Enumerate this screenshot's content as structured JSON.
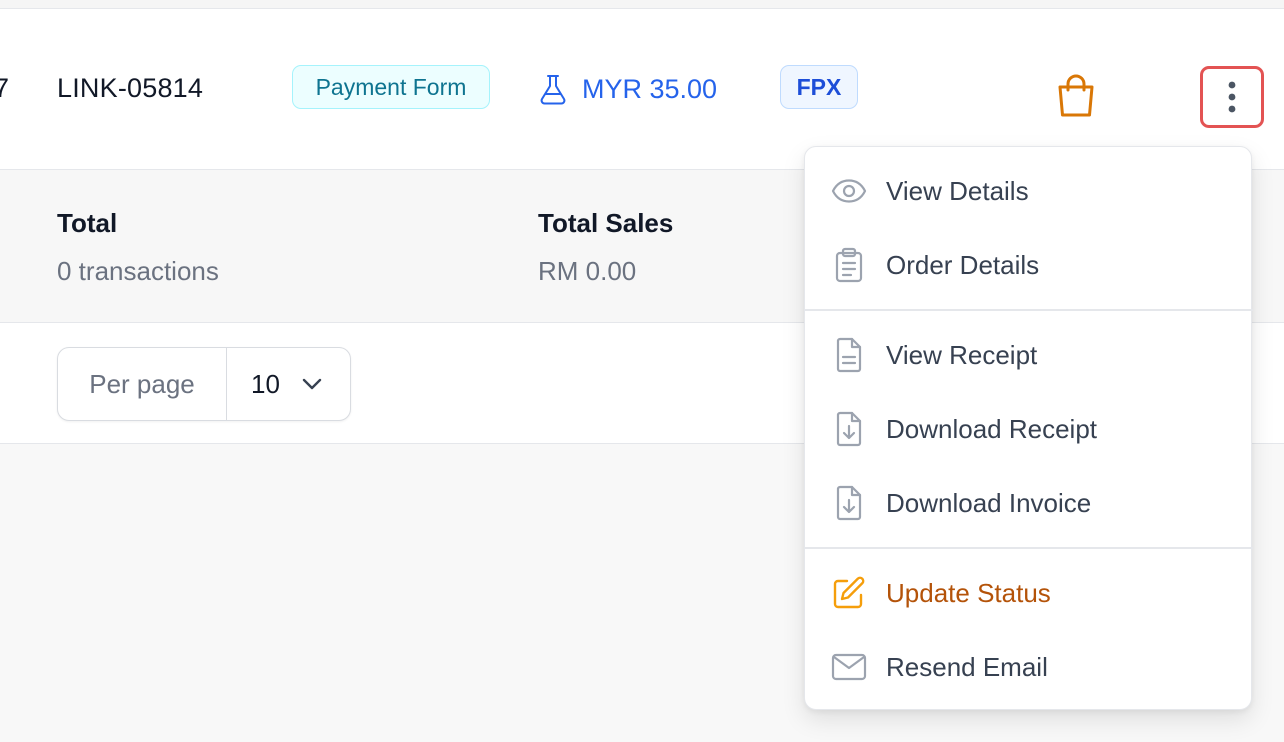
{
  "row": {
    "prefix_fragment": "7",
    "link_id": "LINK-05814",
    "type_badge": "Payment Form",
    "amount": "MYR 35.00",
    "method_badge": "FPX",
    "icons": {
      "amount_icon": "flask-icon",
      "channel_icon": "shopping-bag-icon",
      "actions_icon": "kebab-menu-icon"
    }
  },
  "summary": {
    "total_label": "Total",
    "total_value": "0 transactions",
    "sales_label": "Total Sales",
    "sales_value": "RM 0.00"
  },
  "pagination": {
    "per_page_label": "Per page",
    "per_page_value": "10"
  },
  "menu": {
    "groups": [
      [
        {
          "label": "View Details",
          "icon": "eye-icon"
        },
        {
          "label": "Order Details",
          "icon": "clipboard-list-icon"
        }
      ],
      [
        {
          "label": "View Receipt",
          "icon": "document-icon"
        },
        {
          "label": "Download Receipt",
          "icon": "document-download-icon"
        },
        {
          "label": "Download Invoice",
          "icon": "document-download-icon"
        }
      ],
      [
        {
          "label": "Update Status",
          "icon": "pencil-square-icon"
        },
        {
          "label": "Resend Email",
          "icon": "envelope-icon"
        }
      ]
    ]
  },
  "colors": {
    "accent_blue": "#2563eb",
    "warning": "#b45309",
    "highlight_border": "#e35353",
    "bag_icon": "#d97706"
  }
}
